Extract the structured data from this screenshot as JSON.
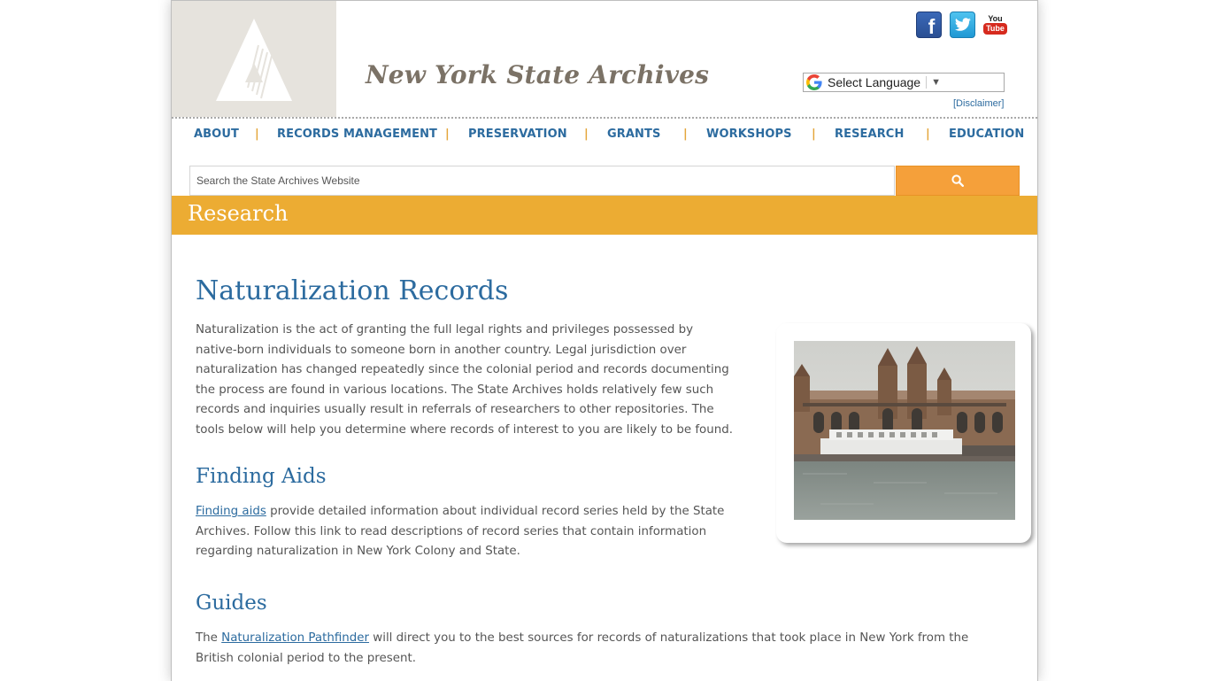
{
  "header": {
    "site_title": "New York State Archives",
    "social": [
      {
        "name": "facebook",
        "icon": "facebook-icon"
      },
      {
        "name": "twitter",
        "icon": "twitter-icon"
      },
      {
        "name": "youtube",
        "icon": "youtube-icon",
        "top_text": "You",
        "bottom_text": "Tube"
      }
    ],
    "language_label": "Select Language",
    "language_arrow": "▼",
    "disclaimer": "[Disclaimer]"
  },
  "nav": {
    "items": [
      "ABOUT",
      "RECORDS MANAGEMENT",
      "PRESERVATION",
      "GRANTS",
      "WORKSHOPS",
      "RESEARCH",
      "EDUCATION"
    ],
    "separator": "|"
  },
  "search": {
    "placeholder": "Search the State Archives Website",
    "button_icon": "search-icon"
  },
  "banner": {
    "title": "Research"
  },
  "main": {
    "title": "Naturalization Records",
    "intro": "Naturalization is the act of granting the full legal rights and privileges possessed by native-born individuals to someone born in another country. Legal jurisdiction over naturalization has changed repeatedly since the colonial period and records documenting the process are found in various locations. The State Archives holds relatively few such records and inquiries usually result in referrals of researchers to other repositories. The tools below will help you determine where records of interest to you are likely to be found.",
    "finding_aids": {
      "heading": "Finding Aids",
      "link": "Finding aids",
      "text": " provide detailed information about individual record series held by the State Archives. Follow this link to read descriptions of record series that contain information regarding naturalization in New York Colony and State."
    },
    "guides": {
      "heading": "Guides",
      "prefix": "The ",
      "link": "Naturalization Pathfinder",
      "text": " will direct you to the best sources for records of naturalizations that took place in New York from the British colonial period to the present."
    }
  },
  "colors": {
    "brand_blue": "#2c6b9f",
    "banner_gold": "#ecac33",
    "search_orange": "#f5a03a",
    "logo_bg": "#e6e3dd"
  }
}
